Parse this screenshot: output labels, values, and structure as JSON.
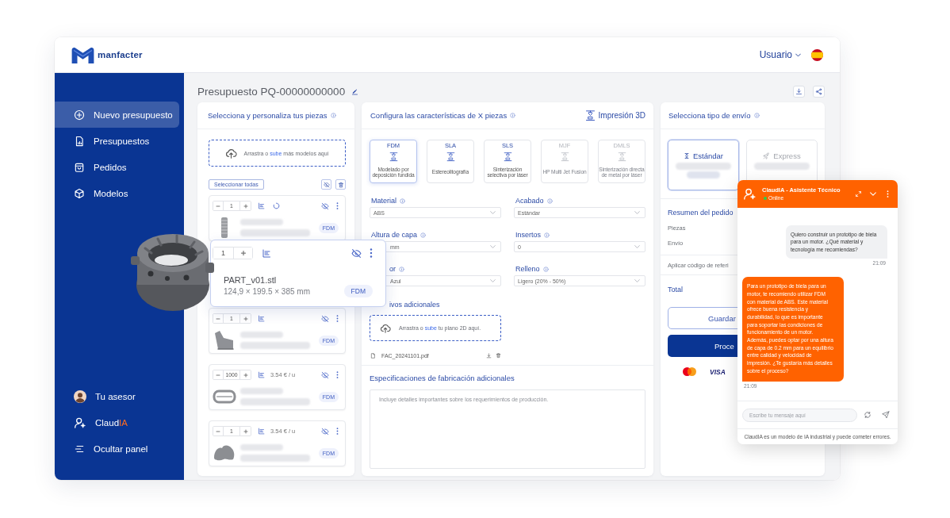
{
  "header": {
    "logo": "manfacter",
    "user_menu": "Usuario"
  },
  "sidebar": {
    "items": [
      {
        "label": "Nuevo presupuesto",
        "selected": true
      },
      {
        "label": "Presupuestos",
        "selected": false
      },
      {
        "label": "Pedidos",
        "selected": false
      },
      {
        "label": "Modelos",
        "selected": false
      }
    ],
    "footer_items": [
      {
        "label": "Tu asesor"
      },
      {
        "label": "Claud",
        "accent": "IA"
      },
      {
        "label": "Ocultar panel"
      }
    ]
  },
  "quote": {
    "title": "Presupuesto PQ-00000000000"
  },
  "pieces": {
    "title": "Selecciona y personaliza tus piezas",
    "info": true,
    "dropzone": {
      "before": "Arrastra o",
      "link": "sube",
      "after": "más modelos aquí"
    },
    "select_all": "Seleccionar todas",
    "items": [
      {
        "quantity": "1",
        "loading": true,
        "technology": "FDM"
      },
      {
        "quantity": "1",
        "loading": false,
        "technology": "FDM"
      },
      {
        "quantity": "1000",
        "price": "3.54 € / u",
        "loading": false,
        "technology": "FDM"
      },
      {
        "quantity": "1",
        "price": "3.54 € / u",
        "loading": false,
        "technology": "FDM"
      }
    ],
    "preview": {
      "quantity": "1",
      "file_name": "PART_v01.stl",
      "dimensions": "124,9 × 199.5 × 385 mm",
      "technology": "FDM"
    }
  },
  "config": {
    "title": "Configura las características de X piezas",
    "info": true,
    "process": "Impresión 3D",
    "technologies": [
      {
        "name": "FDM",
        "description": "Modelado por deposición fundida",
        "selected": true,
        "disabled": false
      },
      {
        "name": "SLA",
        "description": "Estereolitografía",
        "selected": false,
        "disabled": false
      },
      {
        "name": "SLS",
        "description": "Sinterización selectiva por láser",
        "selected": false,
        "disabled": false
      },
      {
        "name": "MJF",
        "description": "HP Multi Jet Fusion",
        "selected": false,
        "disabled": true
      },
      {
        "name": "DMLS",
        "description": "Sinterización directa de metal por láser",
        "selected": false,
        "disabled": true
      }
    ],
    "fields": [
      {
        "label": "Material",
        "info": true,
        "value": "ABS"
      },
      {
        "label": "Acabado",
        "info": true,
        "value": "Estándar"
      },
      {
        "label": "Altura de capa",
        "info": true,
        "value": "mm"
      },
      {
        "label": "Insertos",
        "info": true,
        "value": "0"
      },
      {
        "label": "or",
        "info": true,
        "value": "Azul"
      },
      {
        "label": "Relleno",
        "info": true,
        "value": "Ligero (20% - 50%)"
      }
    ],
    "attachments": {
      "label": "ivos adicionales",
      "dropzone": {
        "before": "Arrastra o",
        "link": "sube",
        "after": "tu plano 2D aquí."
      },
      "files": [
        {
          "name": "FAC_20241101.pdf"
        }
      ]
    },
    "specs": {
      "title": "Especificaciones de fabricación adicionales",
      "placeholder": "Incluye detalles importantes sobre los requerimientos de producción."
    }
  },
  "shipping": {
    "title": "Selecciona tipo de envío",
    "info": true,
    "options": [
      {
        "label": "Estándar",
        "selected": true
      },
      {
        "label": "Express",
        "selected": false
      }
    ],
    "summary": {
      "title": "Resumen del pedido",
      "rows": [
        "Piezas",
        "Envío"
      ],
      "referral": "Aplicar código de referi",
      "total": "Total"
    },
    "buttons": [
      {
        "label": "Guardar",
        "kind": "outline"
      },
      {
        "label": "Proce",
        "kind": "primary"
      }
    ],
    "payment_text": "VISA"
  },
  "chat": {
    "title": "ClaudIA - Asistente Técnico",
    "status": {
      "label": "Online",
      "online": true
    },
    "messages": [
      {
        "kind": "user",
        "text": "Quiero construir un prototipo de biela para un motor. ¿Qué material y tecnología me recomiendas?",
        "time": "21:09"
      },
      {
        "kind": "bot",
        "text": "Para un prototipo de biela para un motor, te recomiendo utilizar FDM con material de ABS. Este material ofrece buena resistencia y durabilidad, lo que es importante para soportar las condiciones de funcionamiento de un motor. Además, puedes optar por una altura de capa de 0.2 mm para un equilibrio entre calidad y velocidad de impresión. ¿Te gustaría más detalles sobre el proceso?",
        "time": "21:09"
      }
    ],
    "input": {
      "placeholder": "Escribe tu mensaje aquí"
    },
    "disclaimer": "ClaudIA es un modelo de IA industrial y puede cometer errores."
  }
}
